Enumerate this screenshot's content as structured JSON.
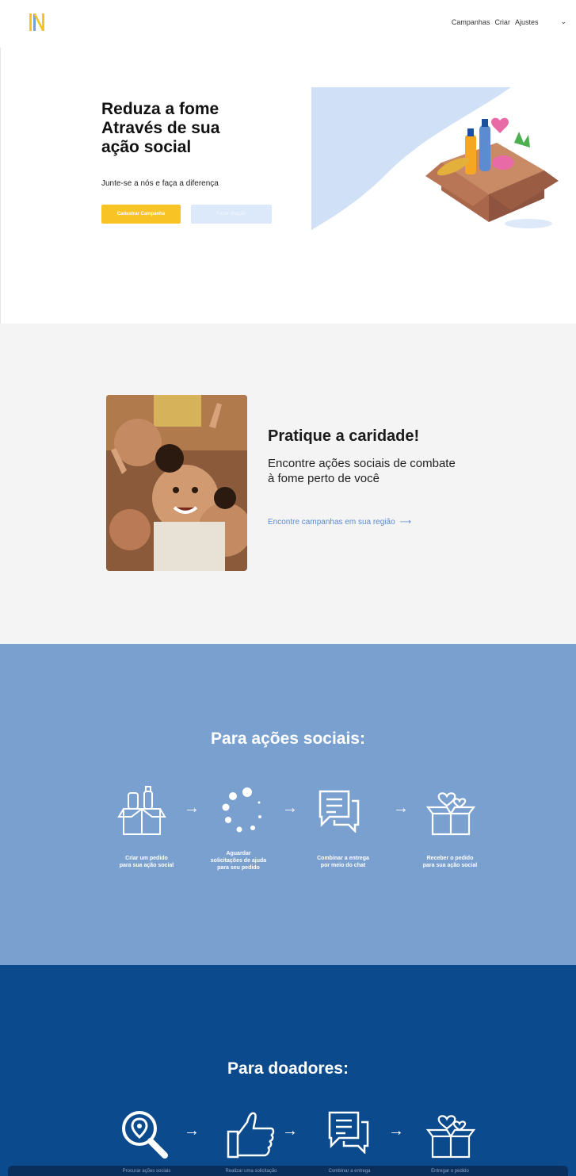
{
  "header": {
    "logo_alt": "logo",
    "nav": [
      "Campanhas",
      "Criar",
      "Ajustes"
    ],
    "chevron_icon": "chevron-down-icon"
  },
  "hero": {
    "title": "Reduza a fome\nAtravés de sua\nação social",
    "subtitle": "Junte-se a nós e faça a diferença",
    "primary_button": "Cadastrar Campanha",
    "secondary_button": "Fazer doação",
    "accent_color": "#f7c325",
    "illustration_icon": "food-donation-box-icon"
  },
  "charity": {
    "title": "Pratique a caridade!",
    "text": "Encontre ações sociais de combate à fome perto de você",
    "link": "Encontre campanhas em sua região",
    "link_arrow": "⟶",
    "photo_icon": "children-photo"
  },
  "social_steps": {
    "title": "Para ações sociais:",
    "background": "#7aa0cf",
    "steps": [
      {
        "icon": "grocery-box-icon",
        "label": "Criar um pedido\npara sua ação social"
      },
      {
        "icon": "loading-dots-icon",
        "label": "Aguardar\nsolicitações de ajuda\npara seu pedido"
      },
      {
        "icon": "chat-icon",
        "label": "Combinar a entrega\npor meio do chat"
      },
      {
        "icon": "gift-hearts-icon",
        "label": "Receber o pedido\npara sua ação social"
      }
    ],
    "arrow": "→"
  },
  "donor_steps": {
    "title": "Para doadores:",
    "background": "#0b4a8c",
    "steps": [
      {
        "icon": "location-search-icon",
        "label": "Procurar ações sociais"
      },
      {
        "icon": "thumbs-up-icon",
        "label": "Realizar uma solicitação"
      },
      {
        "icon": "chat-icon",
        "label": "Combinar a entrega"
      },
      {
        "icon": "gift-hearts-icon",
        "label": "Entregar o pedido"
      }
    ],
    "arrow": "→"
  }
}
